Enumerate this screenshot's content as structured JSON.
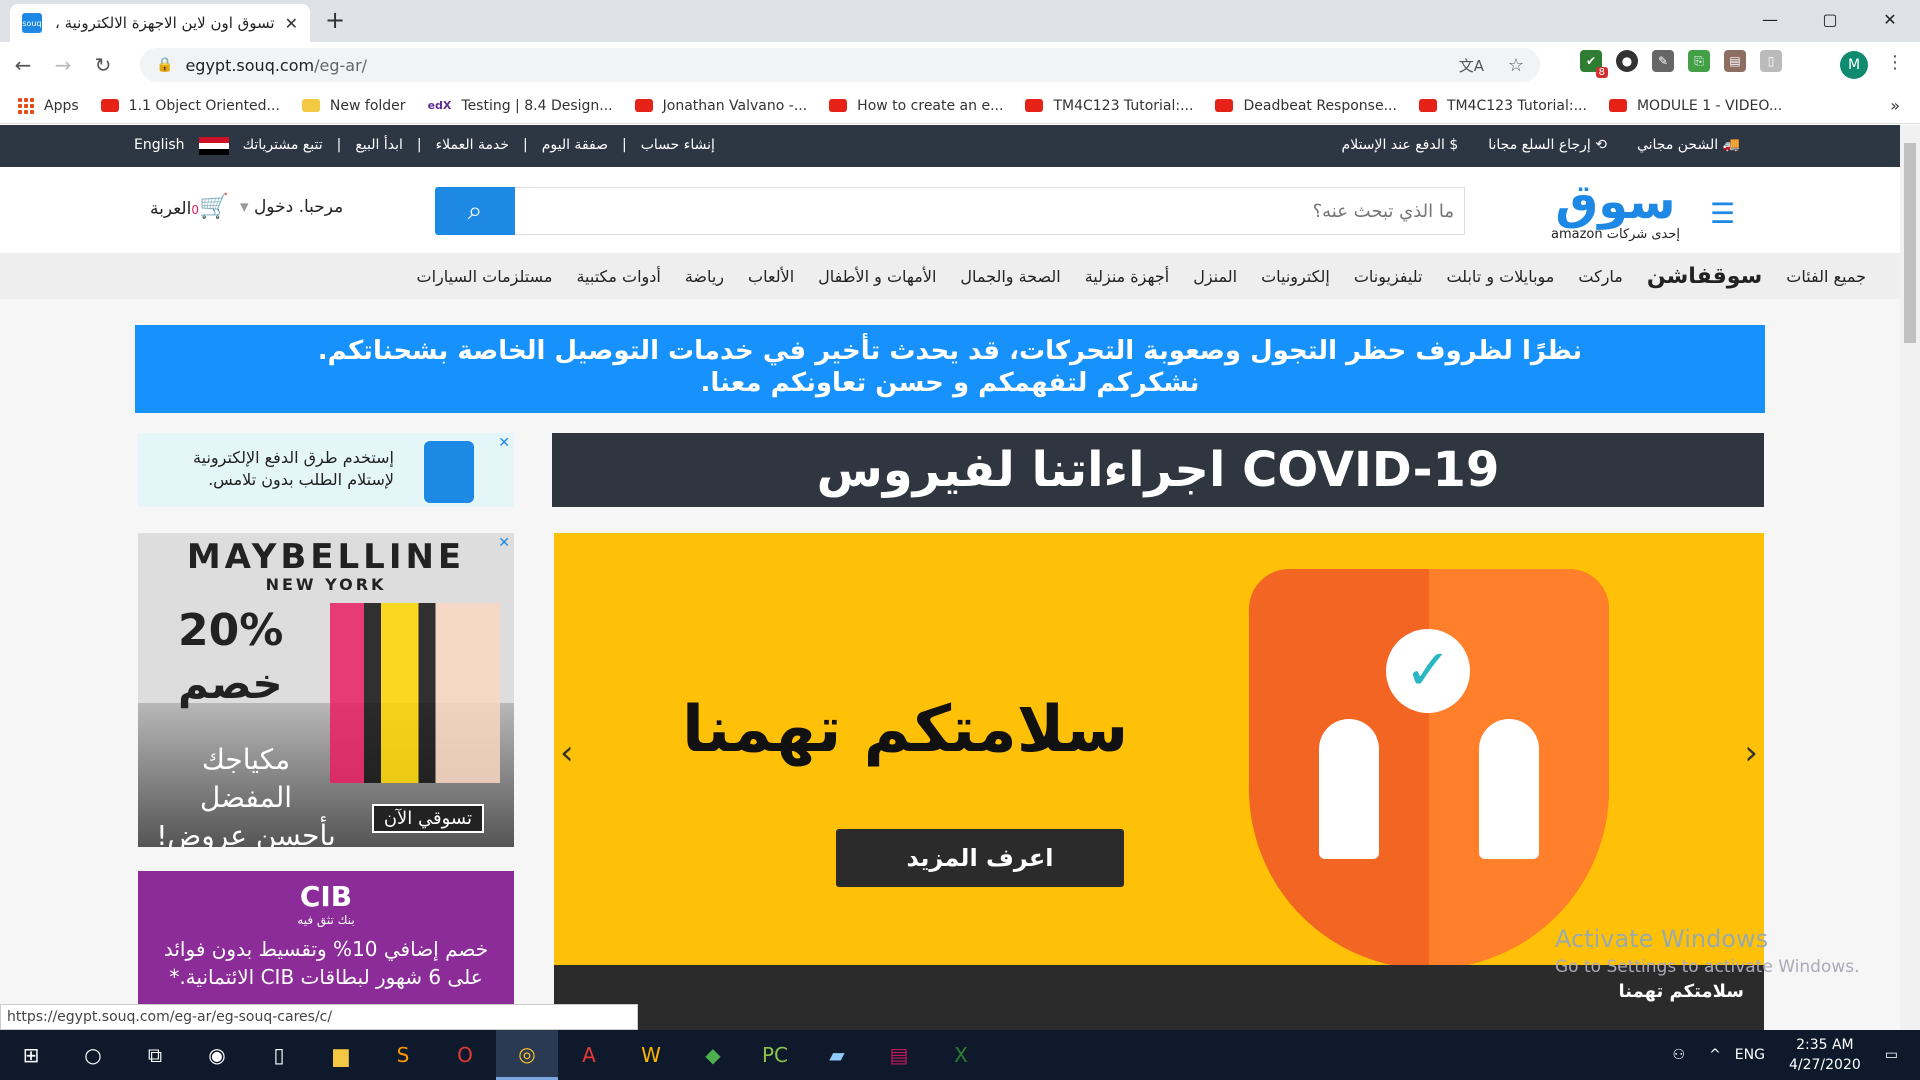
{
  "browser": {
    "tab_title": "تسوق اون لاين الاجهزة الالكترونية ،",
    "tab_close": "✕",
    "new_tab": "+",
    "url_host": "egypt.souq.com",
    "url_path": "/eg-ar/",
    "window_controls": [
      "—",
      "▢",
      "✕"
    ],
    "profile_initial": "M",
    "ext_badge": "8"
  },
  "bookmarks": [
    {
      "label": "Apps",
      "icon": "apps-grid-icon"
    },
    {
      "label": "1.1 Object Oriented...",
      "icon": "youtube-icon"
    },
    {
      "label": "New folder",
      "icon": "folder-icon"
    },
    {
      "label": "Testing | 8.4 Design...",
      "icon": "edx-icon"
    },
    {
      "label": "Jonathan Valvano -...",
      "icon": "youtube-icon"
    },
    {
      "label": "How to create an e...",
      "icon": "youtube-icon"
    },
    {
      "label": "TM4C123 Tutorial:...",
      "icon": "youtube-icon"
    },
    {
      "label": "Deadbeat Response...",
      "icon": "youtube-icon"
    },
    {
      "label": "TM4C123 Tutorial:...",
      "icon": "youtube-icon"
    },
    {
      "label": "MODULE 1 - VIDEO...",
      "icon": "youtube-icon"
    }
  ],
  "topstrip": {
    "right": [
      "الشحن مجاني",
      "إرجاع السلع مجانا",
      "الدفع عند الإستلام"
    ],
    "left": [
      "إنشاء حساب",
      "صفقة اليوم",
      "خدمة العملاء",
      "ابدأ البيع",
      "تتبع مشترياتك"
    ],
    "language": "English"
  },
  "header": {
    "logo_word": "سوق",
    "logo_tag": "إحدى شركات amazon",
    "search_placeholder": "ما الذي تبحث عنه؟",
    "greeting": "مرحبا. دخول",
    "cart_label": "العربة",
    "cart_count": "0"
  },
  "categories": [
    "جميع الفئات",
    "سوقفاشن",
    "ماركت",
    "موبايلات و تابلت",
    "تليفزيونات",
    "إلكترونيات",
    "المنزل",
    "أجهزة منزلية",
    "الصحة والجمال",
    "الأمهات و الأطفال",
    "الألعاب",
    "رياضة",
    "أدوات مكتبية",
    "مستلزمات السيارات"
  ],
  "notice": {
    "line1": "نظرًا لظروف حظر التجول وصعوبة التحركات، قد يحدث تأخير في خدمات التوصيل الخاصة بشحناتكم.",
    "line2": "نشكركم لتفهمكم و حسن تعاونكم معنا."
  },
  "covid_banner": "اجراءاتنا لفيروس COVID-19",
  "ad1": {
    "line1": "إستخدم طرق الدفع الإلكترونية",
    "line2": "لإستلام الطلب بدون تلامس."
  },
  "ad2": {
    "brand": "MAYBELLINE",
    "brand_sub": "NEW YORK",
    "pct": "20%",
    "khasm": "خصم",
    "makeup": "مكياجك المفضل بأحسن عروض!",
    "shop": "تسوقي الآن"
  },
  "ad3": {
    "logo": "CIB",
    "sub": "بنك تثق فيه",
    "line1": "خصم إضافي 10% وتقسيط بدون فوائد",
    "line2": "على 6 شهور لبطاقات CIB الائتمانية.*"
  },
  "hero": {
    "caption": "سلامتكم تهمنا",
    "cta": "اعرف المزيد",
    "bar_title": "سلامتكم تهمنا"
  },
  "watermark": {
    "title": "Activate Windows",
    "sub": "Go to Settings to activate Windows."
  },
  "status_url": "https://egypt.souq.com/eg-ar/eg-souq-cares/c/",
  "taskbar": {
    "lang": "ENG",
    "time": "2:35 AM",
    "date": "4/27/2020"
  }
}
